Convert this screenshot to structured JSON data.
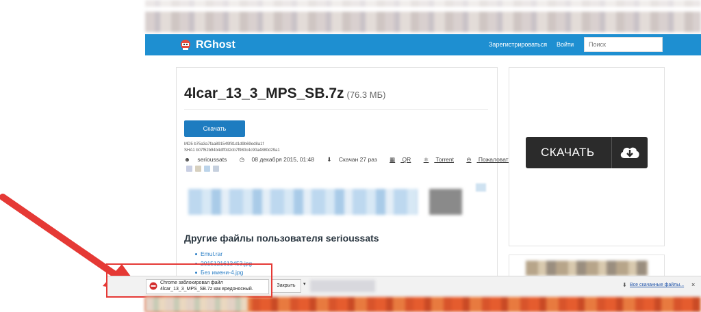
{
  "site": {
    "brand": "RGhost",
    "nav": {
      "register": "Зарегистрироваться",
      "login": "Войти"
    },
    "search": {
      "placeholder": "Поиск"
    }
  },
  "file": {
    "name": "4lcar_13_3_MPS_SB.7z",
    "size": "(76.3 МБ)",
    "download_label": "Скачать",
    "md5": "MD5  b75a3a7faa891549f81d1d9b69ed8a1f",
    "sha1": "SHA1 b07f52b94b4dff0d2cb7f980c4c90a4880d29a1",
    "uploader": "serioussats",
    "date": "08 декабря 2015, 01:48",
    "downloads": "Скачан 27 раз",
    "qr": "QR",
    "torrent": "Torrent",
    "complain": "Пожаловаться"
  },
  "user_files": {
    "title": "Другие файлы пользователя serioussats",
    "items": [
      "Emul.rar",
      "2015121613453.jpg",
      "Без имени-4.jpg"
    ]
  },
  "big_download": {
    "label": "СКАЧАТЬ"
  },
  "download_bar": {
    "message_line1": "Chrome заблокировал файл",
    "message_line2": "4lcar_13_3_MPS_SB.7z как вредоносный.",
    "close_label": "Закрыть",
    "all_downloads": "Все скачанные файлы...",
    "dismiss": "×"
  },
  "colors": {
    "header": "#1e8fd1",
    "accent": "#1e7cc0",
    "arrow": "#e53935"
  }
}
